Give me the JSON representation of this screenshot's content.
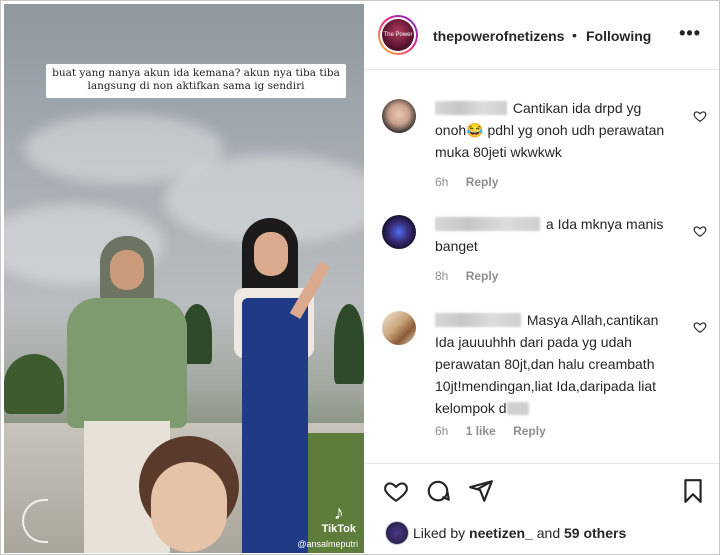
{
  "video": {
    "caption": "buat yang nanya akun ida kemana? akun nya tiba tiba langsung di non aktifkan sama ig sendiri",
    "watermark": "TikTok",
    "watermark_user": "@ansalmeputri"
  },
  "header": {
    "avatar_text": "The Power of Netizens",
    "username": "thepowerofnetizens",
    "separator": "•",
    "follow_label": "Following",
    "more_label": "•••"
  },
  "comments": [
    {
      "text": "Cantikan ida drpd yg onoh😂 pdhl yg onoh udh perawatan muka 80jeti wkwkwk",
      "time": "6h",
      "likes": "",
      "reply": "Reply"
    },
    {
      "text": "a Ida mknya manis banget",
      "time": "8h",
      "likes": "",
      "reply": "Reply"
    },
    {
      "text": "Masya Allah,cantikan Ida jauuuhhh dari pada yg udah perawatan 80jt,dan halu creambath 10jt!mendingan,liat Ida,daripada liat kelompok d",
      "text_tail": "",
      "time": "6h",
      "likes": "1 like",
      "reply": "Reply"
    }
  ],
  "likes": {
    "prefix": "Liked by",
    "user": "neetizen_",
    "mid": "and",
    "others": "59 others"
  },
  "colors": {
    "text": "#262626",
    "muted": "#8e8e8e",
    "story_ring": "#ee2a7b"
  },
  "icons": [
    "heart-icon",
    "comment-icon",
    "share-icon",
    "bookmark-icon",
    "more-icon",
    "tiktok-icon"
  ]
}
